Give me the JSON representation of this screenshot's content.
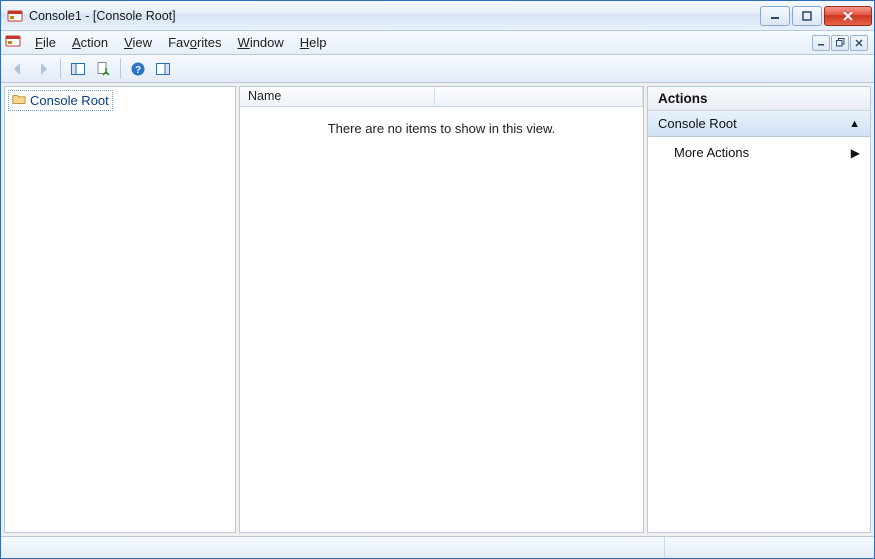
{
  "window": {
    "title": "Console1 - [Console Root]"
  },
  "menus": {
    "file": "File",
    "action": "Action",
    "view": "View",
    "favorites": "Favorites",
    "window": "Window",
    "help": "Help"
  },
  "tree": {
    "root_label": "Console Root"
  },
  "list": {
    "columns": {
      "name": "Name"
    },
    "empty_message": "There are no items to show in this view."
  },
  "actions": {
    "header": "Actions",
    "section_label": "Console Root",
    "more_actions": "More Actions"
  }
}
